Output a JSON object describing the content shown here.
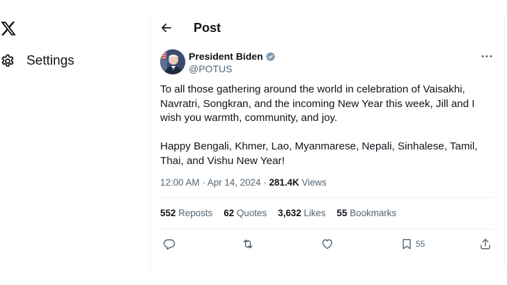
{
  "nav": {
    "settings_label": "Settings",
    "logo_icon": "x-logo-icon",
    "settings_icon": "gear-icon"
  },
  "header": {
    "title": "Post",
    "back_icon": "back-arrow-icon"
  },
  "post": {
    "author_name": "President Biden",
    "author_handle": "@POTUS",
    "paragraphs": [
      "To all those gathering around the world in celebration of Vaisakhi, Navratri, Songkran, and the incoming New Year this week, Jill and I wish you warmth, community, and joy.",
      "Happy Bengali, Khmer, Lao, Myanmarese, Nepali, Sinhalese, Tamil, Thai, and Vishu New Year!"
    ],
    "time": "12:00 AM",
    "date": "Apr 14, 2024",
    "views_count": "281.4K",
    "views_label": "Views"
  },
  "stats": [
    {
      "count": "552",
      "label": "Reposts"
    },
    {
      "count": "62",
      "label": "Quotes"
    },
    {
      "count": "3,632",
      "label": "Likes"
    },
    {
      "count": "55",
      "label": "Bookmarks"
    }
  ],
  "actions": {
    "bookmark_count": "55"
  },
  "colors": {
    "text": "#0f1419",
    "secondary": "#536471",
    "border": "#eff3f4",
    "verified": "#829aab"
  }
}
